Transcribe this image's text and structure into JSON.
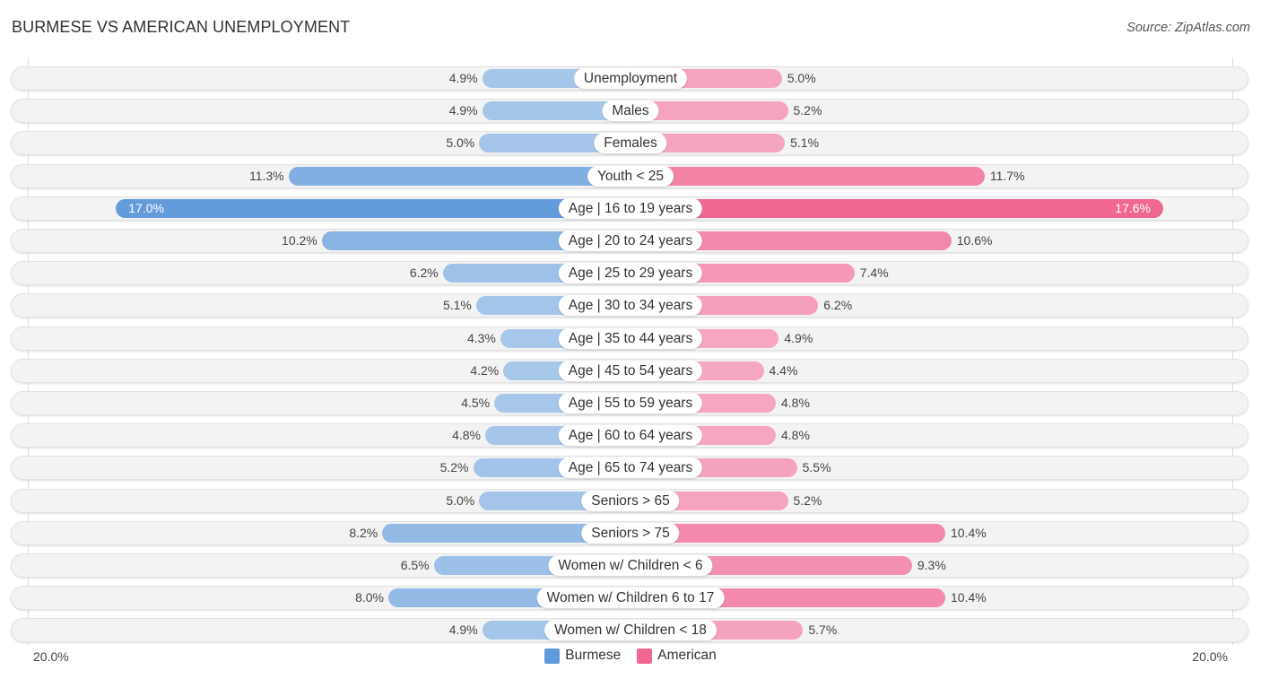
{
  "header": {
    "title": "BURMESE VS AMERICAN UNEMPLOYMENT",
    "source": "Source: ZipAtlas.com"
  },
  "colors": {
    "burmese": "#6199d9",
    "american": "#f06791",
    "burmese_light": "#a8c8ea",
    "american_light": "#f6a9c1"
  },
  "chart_data": {
    "type": "bar",
    "orientation": "horizontal-diverging",
    "title": "BURMESE VS AMERICAN UNEMPLOYMENT",
    "xlabel": "",
    "ylabel": "",
    "xlim": [
      -20.0,
      20.0
    ],
    "axis_labels": {
      "left": "20.0%",
      "right": "20.0%"
    },
    "legend": {
      "position": "bottom-center",
      "entries": [
        "Burmese",
        "American"
      ]
    },
    "categories": [
      "Unemployment",
      "Males",
      "Females",
      "Youth < 25",
      "Age | 16 to 19 years",
      "Age | 20 to 24 years",
      "Age | 25 to 29 years",
      "Age | 30 to 34 years",
      "Age | 35 to 44 years",
      "Age | 45 to 54 years",
      "Age | 55 to 59 years",
      "Age | 60 to 64 years",
      "Age | 65 to 74 years",
      "Seniors > 65",
      "Seniors > 75",
      "Women w/ Children < 6",
      "Women w/ Children 6 to 17",
      "Women w/ Children < 18"
    ],
    "series": [
      {
        "name": "Burmese",
        "side": "left",
        "values": [
          4.9,
          4.9,
          5.0,
          11.3,
          17.0,
          10.2,
          6.2,
          5.1,
          4.3,
          4.2,
          4.5,
          4.8,
          5.2,
          5.0,
          8.2,
          6.5,
          8.0,
          4.9
        ],
        "labels": [
          "4.9%",
          "4.9%",
          "5.0%",
          "11.3%",
          "17.0%",
          "10.2%",
          "6.2%",
          "5.1%",
          "4.3%",
          "4.2%",
          "4.5%",
          "4.8%",
          "5.2%",
          "5.0%",
          "8.2%",
          "6.5%",
          "8.0%",
          "4.9%"
        ]
      },
      {
        "name": "American",
        "side": "right",
        "values": [
          5.0,
          5.2,
          5.1,
          11.7,
          17.6,
          10.6,
          7.4,
          6.2,
          4.9,
          4.4,
          4.8,
          4.8,
          5.5,
          5.2,
          10.4,
          9.3,
          10.4,
          5.7
        ],
        "labels": [
          "5.0%",
          "5.2%",
          "5.1%",
          "11.7%",
          "17.6%",
          "10.6%",
          "7.4%",
          "6.2%",
          "4.9%",
          "4.4%",
          "4.8%",
          "4.8%",
          "5.5%",
          "5.2%",
          "10.4%",
          "9.3%",
          "10.4%",
          "5.7%"
        ]
      }
    ]
  }
}
